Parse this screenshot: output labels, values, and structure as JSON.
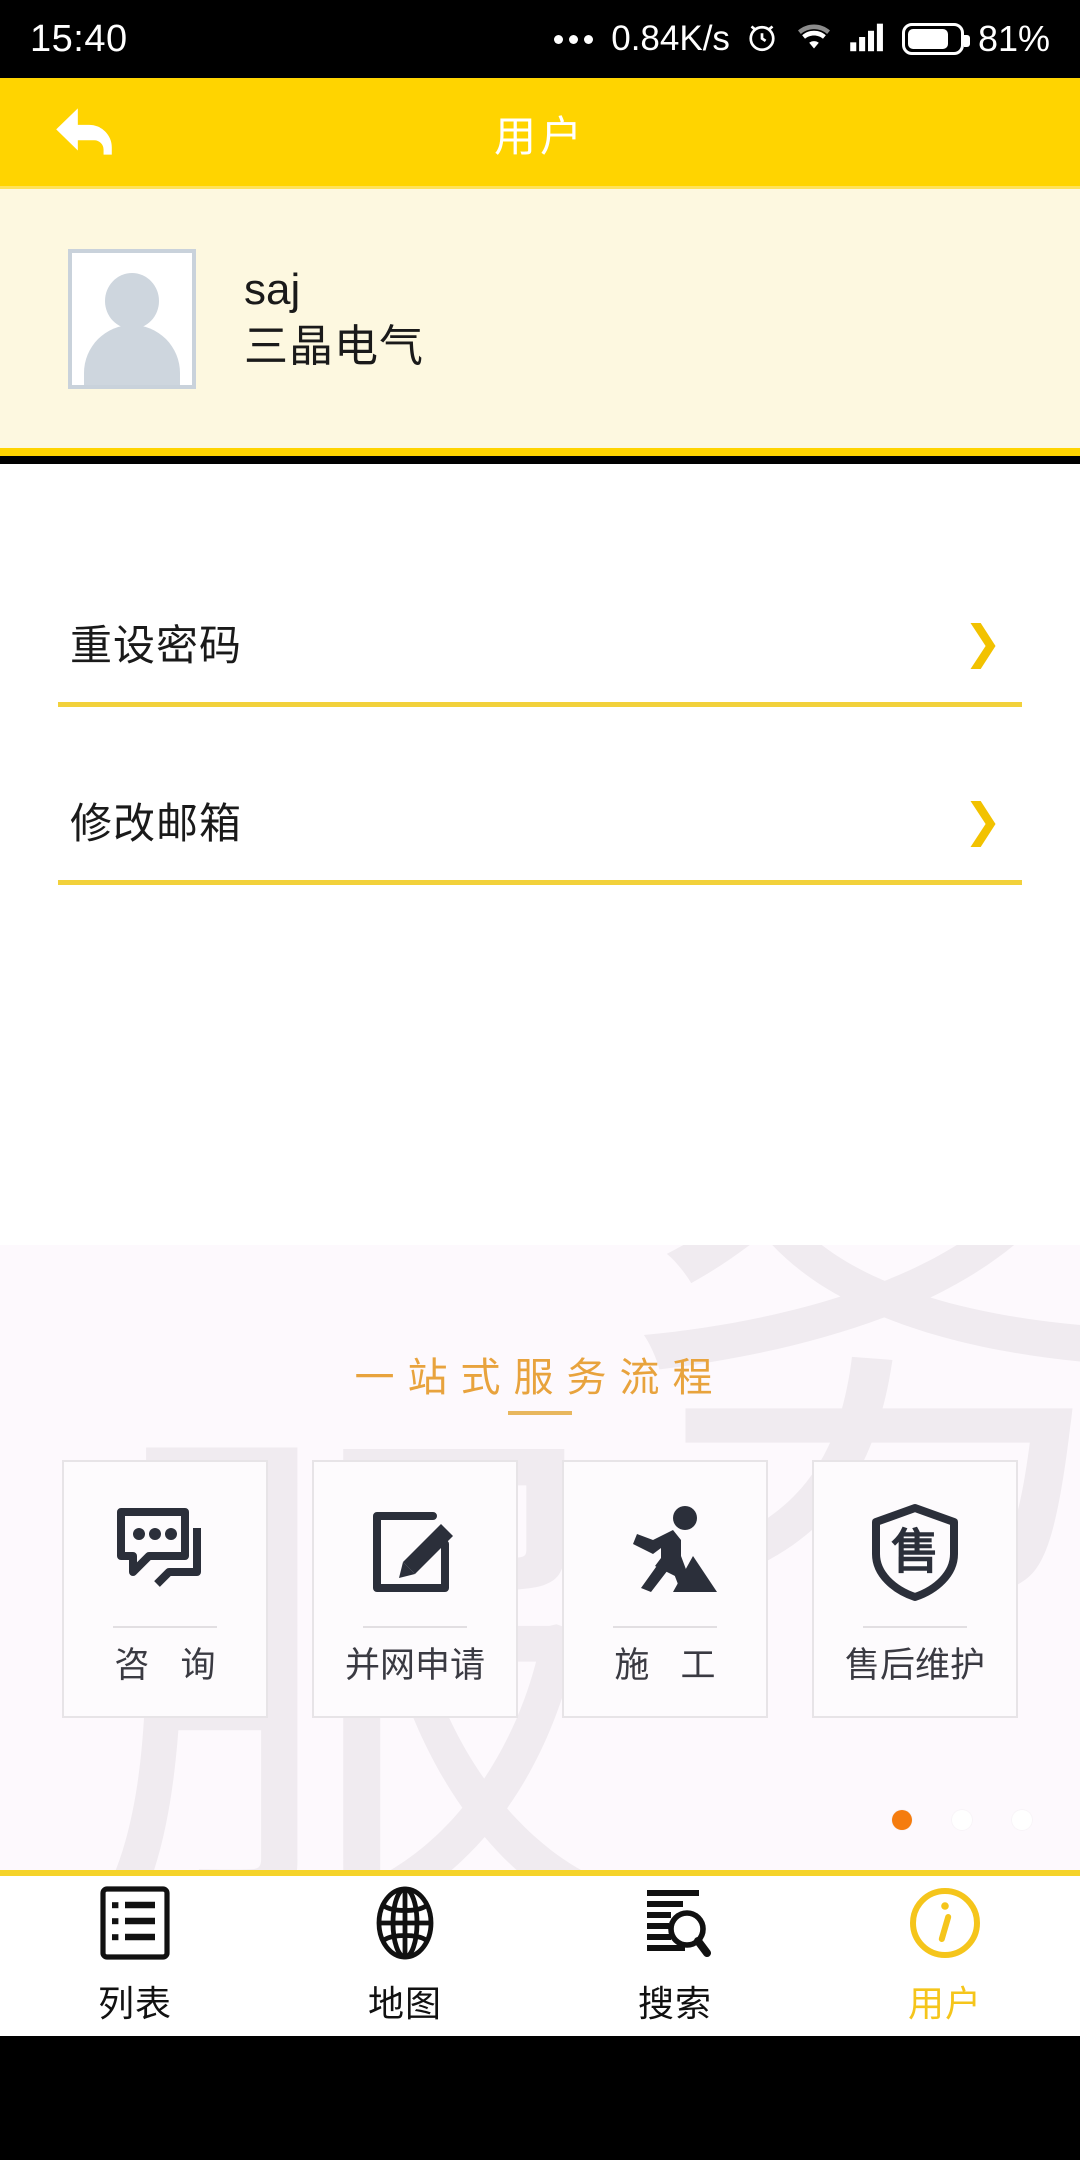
{
  "status_bar": {
    "time": "15:40",
    "network_speed": "0.84K/s",
    "battery_percent": "81%",
    "icons": [
      "more-dots-icon",
      "alarm-icon",
      "wifi-icon",
      "cellular-signal-icon",
      "battery-icon"
    ]
  },
  "header": {
    "title": "用户",
    "back_icon": "back-arrow-icon",
    "background_color": "#FFD400"
  },
  "profile": {
    "avatar_icon": "avatar-placeholder-icon",
    "name": "saj",
    "company": "三晶电气",
    "background_color": "#FDF8E0"
  },
  "settings": {
    "rows": [
      {
        "label": "重设密码",
        "chevron": "chevron-right-icon"
      },
      {
        "label": "修改邮箱",
        "chevron": "chevron-right-icon"
      }
    ],
    "divider_color": "#F2D13B",
    "chevron_color": "#F2C200"
  },
  "service": {
    "title": "一站式服务流程",
    "title_color": "#E8A33D",
    "watermark_chars": [
      "务",
      "服"
    ],
    "cards": [
      {
        "label": "咨 询",
        "icon": "chat-bubbles-icon"
      },
      {
        "label": "并网申请",
        "icon": "edit-square-icon"
      },
      {
        "label": "施 工",
        "icon": "construction-worker-icon"
      },
      {
        "label": "售后维护",
        "icon": "shield-after-sales-icon",
        "shield_char": "售"
      }
    ],
    "pagination": {
      "total": 3,
      "active_index": 0,
      "active_color": "#F57C0E"
    }
  },
  "bottom_nav": {
    "items": [
      {
        "label": "列表",
        "icon": "list-icon",
        "active": false
      },
      {
        "label": "地图",
        "icon": "globe-icon",
        "active": false
      },
      {
        "label": "搜索",
        "icon": "document-search-icon",
        "active": false
      },
      {
        "label": "用户",
        "icon": "info-circle-icon",
        "active": true
      }
    ],
    "active_color": "#F5C51B",
    "top_border_color": "#F5D32A"
  }
}
